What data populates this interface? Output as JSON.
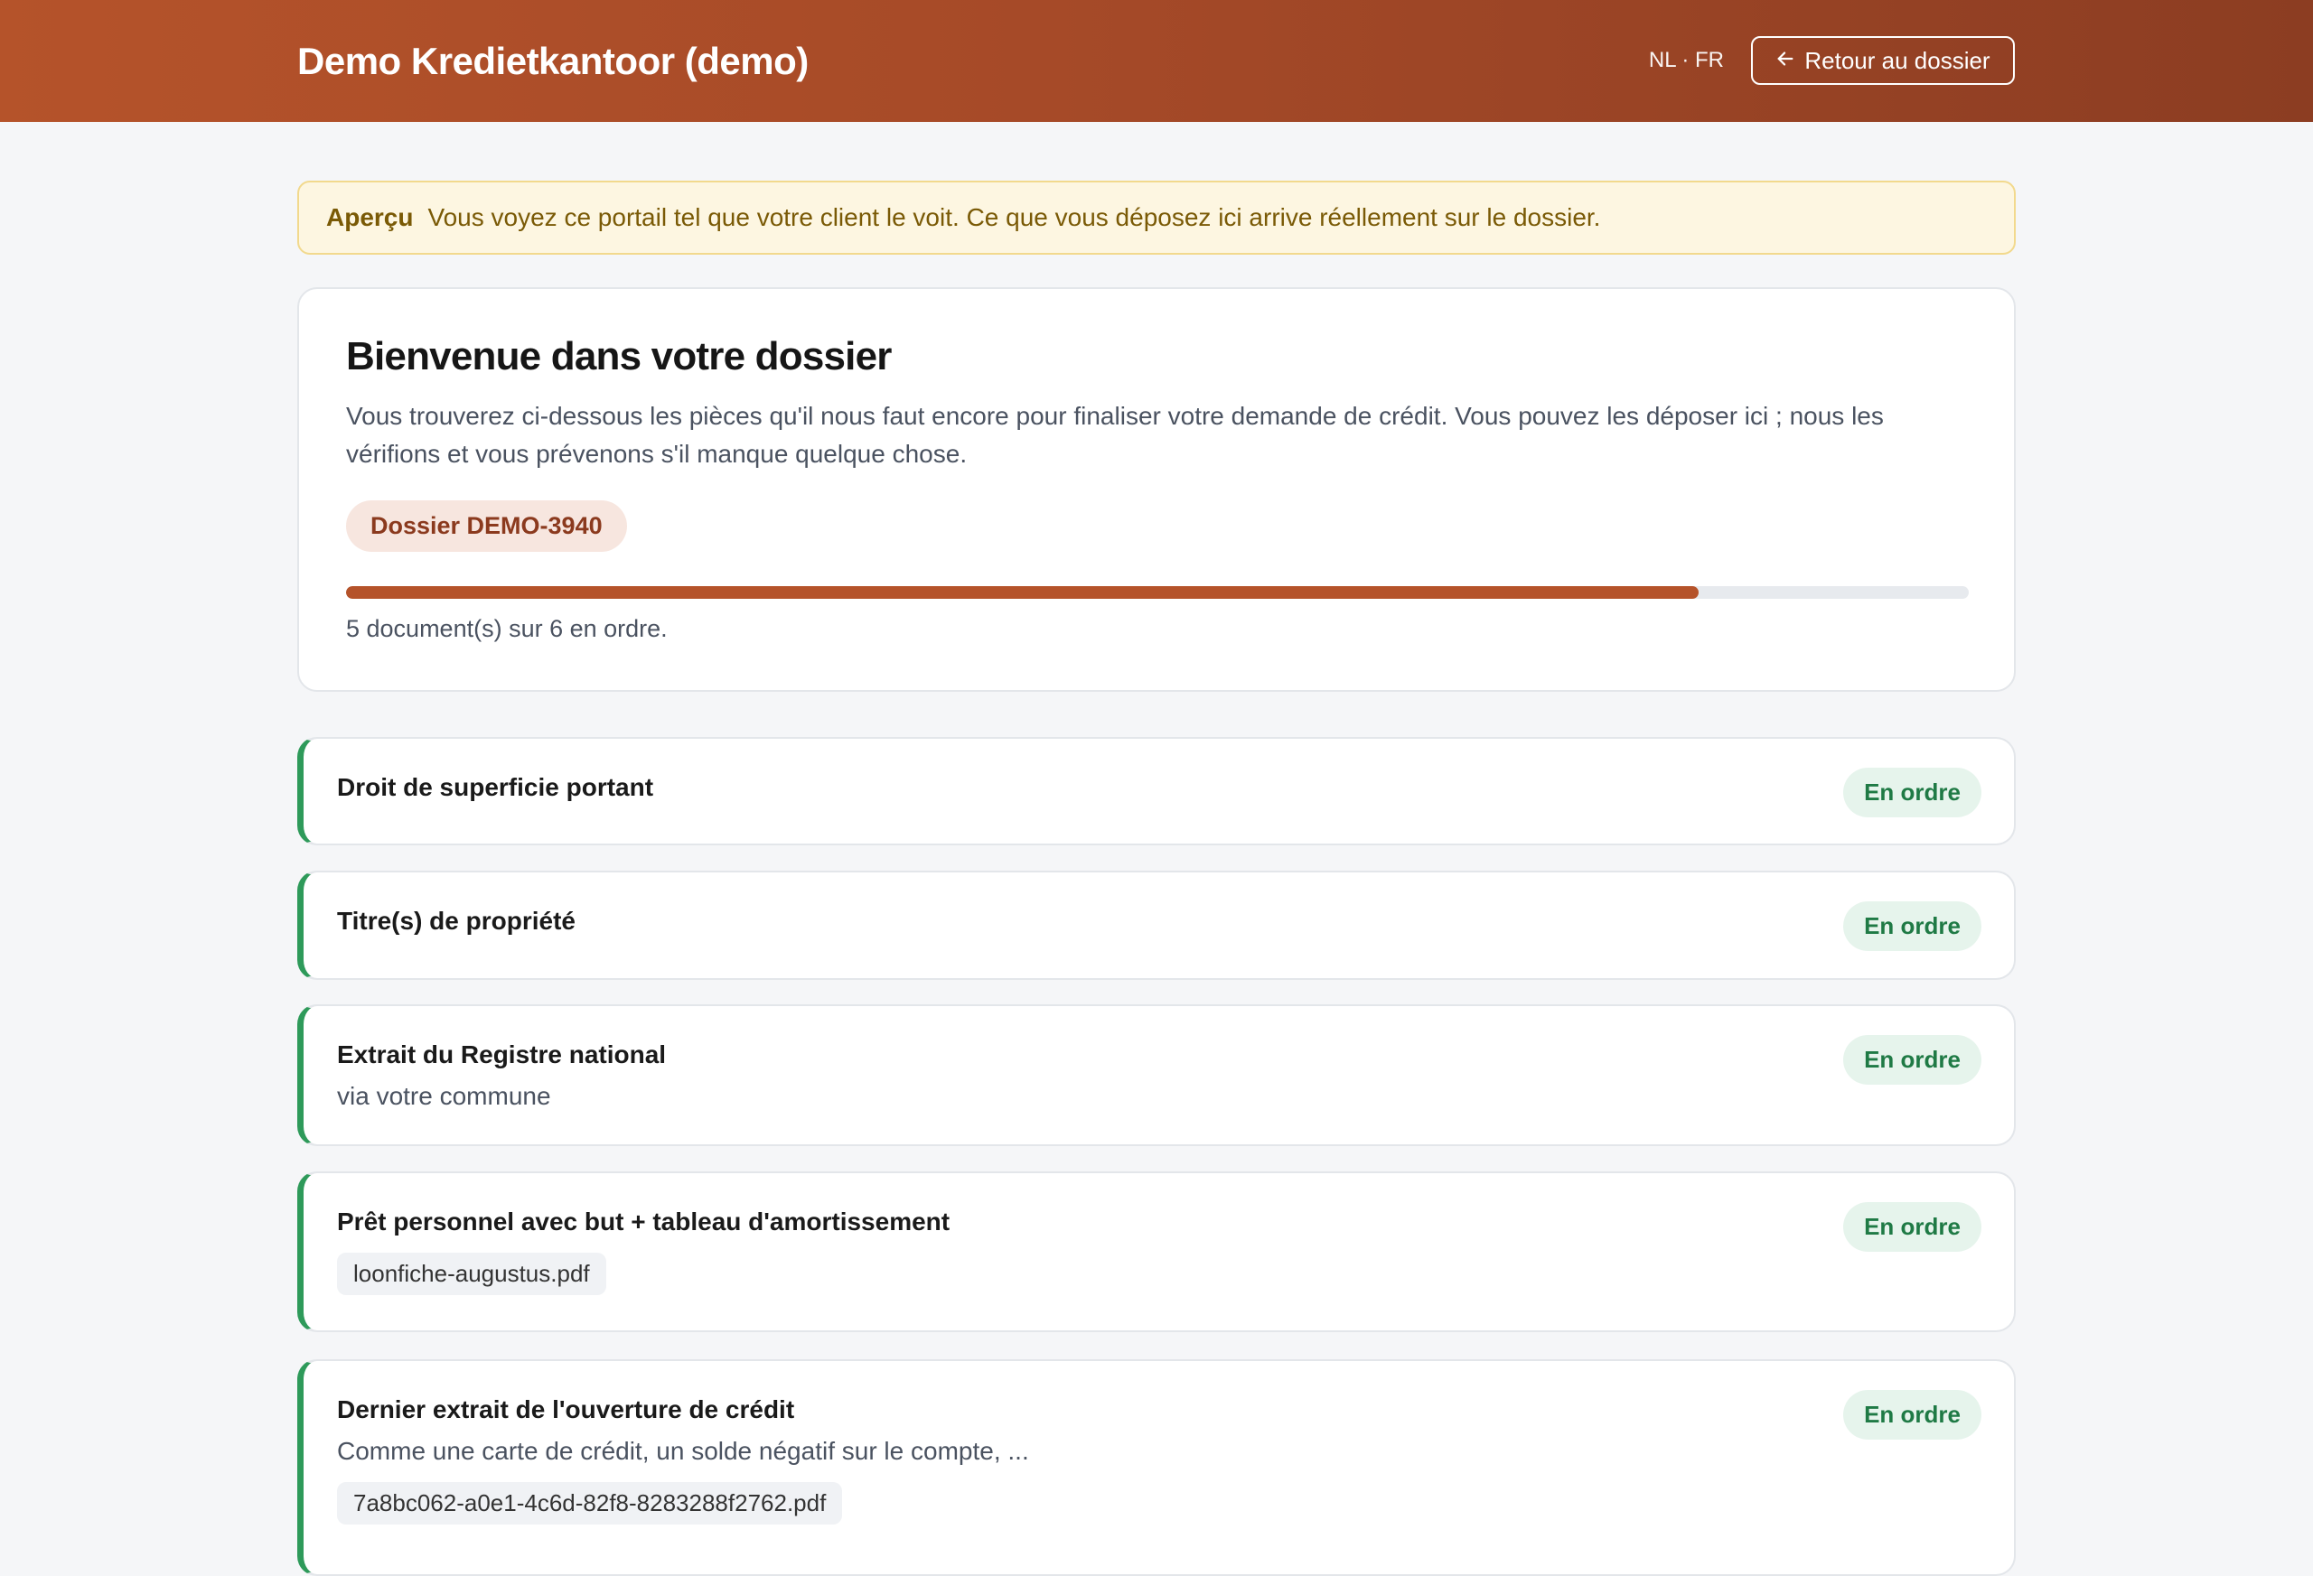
{
  "header": {
    "brand": "Demo Kredietkantoor (demo)",
    "lang": "NL · FR",
    "back_label": "Retour au dossier"
  },
  "preview": {
    "tag": "Aperçu",
    "text": "Vous voyez ce portail tel que votre client le voit. Ce que vous déposez ici arrive réellement sur le dossier."
  },
  "welcome": {
    "title": "Bienvenue dans votre dossier",
    "text": "Vous trouverez ci-dessous les pièces qu'il nous faut encore pour finaliser votre demande de crédit. Vous pouvez les déposer ici ; nous les vérifions et vous prévenons s'il manque quelque chose.",
    "dossier": "Dossier DEMO-3940",
    "progress_fraction": 0.8333,
    "progress_text": "5 document(s) sur 6 en ordre."
  },
  "documents": [
    {
      "title": "Droit de superficie portant",
      "status": "En ordre"
    },
    {
      "title": "Titre(s) de propriété",
      "status": "En ordre"
    },
    {
      "title": "Extrait du Registre national",
      "subtitle": "via votre commune",
      "status": "En ordre"
    },
    {
      "title": "Prêt personnel avec but + tableau d'amortissement",
      "file": "loonfiche-augustus.pdf",
      "status": "En ordre"
    },
    {
      "title": "Dernier extrait de l'ouverture de crédit",
      "subtitle": "Comme une carte de crédit, un solde négatif sur le compte, ...",
      "file": "7a8bc062-a0e1-4c6d-82f8-8283288f2762.pdf",
      "status": "En ordre"
    }
  ],
  "colors": {
    "accent": "#b5532a",
    "success": "#2e9a5a",
    "warning_bg": "#fdf6e1"
  },
  "icons": {
    "back": "arrow-left-icon"
  }
}
